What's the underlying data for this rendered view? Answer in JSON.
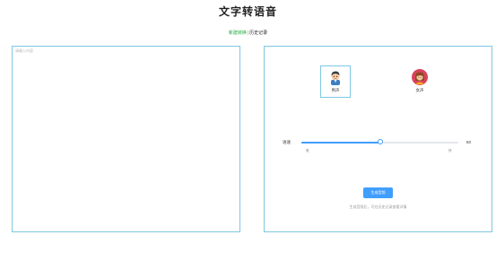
{
  "page": {
    "title": "文字转语音"
  },
  "tabs": {
    "new_task": "新建转换",
    "separator": "|",
    "history": "历史记录"
  },
  "input": {
    "placeholder": "请输入内容",
    "value": ""
  },
  "voices": [
    {
      "label": "男声",
      "icon": "male-avatar-icon",
      "selected": true
    },
    {
      "label": "女声",
      "icon": "female-avatar-icon",
      "selected": false
    }
  ],
  "speed": {
    "label": "语速",
    "value": 50,
    "min_label": "慢",
    "max_label": "快",
    "fraction": 0.5
  },
  "action": {
    "generate_label": "生成音频",
    "hint": "生成音频后，可在历史记录查看详情"
  },
  "colors": {
    "accent": "#409eff",
    "tab_active": "#28a745",
    "panel_border": "#7ec8e3"
  }
}
